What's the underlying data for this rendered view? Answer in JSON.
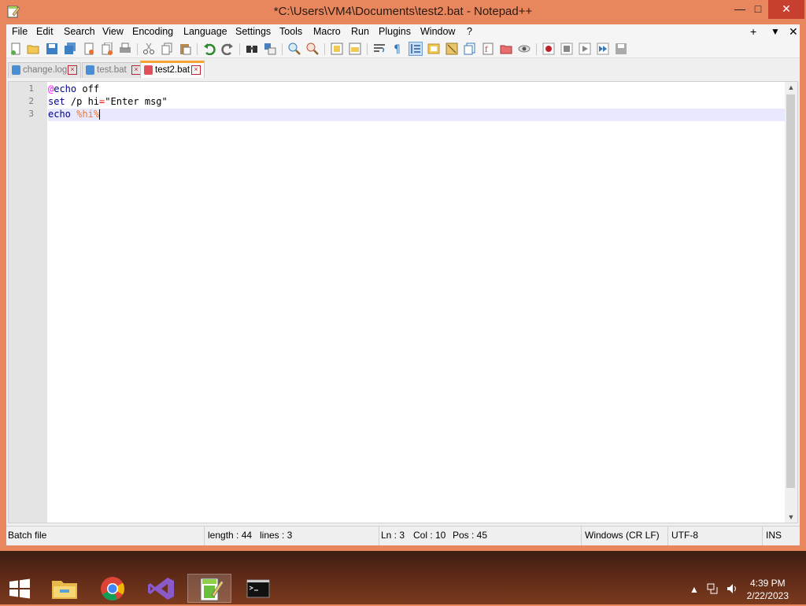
{
  "window": {
    "title": "*C:\\Users\\VM4\\Documents\\test2.bat - Notepad++",
    "minimize": "—",
    "maximize": "□",
    "close": "✕"
  },
  "menu": {
    "items": [
      "File",
      "Edit",
      "Search",
      "View",
      "Encoding",
      "Language",
      "Settings",
      "Tools",
      "Macro",
      "Run",
      "Plugins",
      "Window",
      "?"
    ],
    "right": [
      "+",
      "▼",
      "✕"
    ]
  },
  "tabs": [
    {
      "label": "change.log",
      "active": false
    },
    {
      "label": "test.bat",
      "active": false
    },
    {
      "label": "test2.bat",
      "active": true
    }
  ],
  "editor": {
    "line_numbers": [
      "1",
      "2",
      "3"
    ],
    "lines": [
      {
        "at": "@",
        "kw": "echo",
        "rest": " off"
      },
      {
        "kw": "set",
        "pre": " /p hi",
        "op": "=",
        "rest": "\"Enter msg\""
      },
      {
        "kw": "echo",
        "sp": " ",
        "var": "%hi%"
      }
    ]
  },
  "status": {
    "language": "Batch file",
    "length": "length : 44",
    "lines": "lines : 3",
    "ln": "Ln : 3",
    "col": "Col : 10",
    "pos": "Pos : 45",
    "eol": "Windows (CR LF)",
    "encoding": "UTF-8",
    "mode": "INS"
  },
  "taskbar": {
    "time": "4:39 PM",
    "date": "2/22/2023",
    "apps": [
      "start-button",
      "file-explorer",
      "chrome",
      "visual-studio",
      "notepad-plus-plus",
      "command-prompt"
    ]
  },
  "colors": {
    "accent": "#e8875d",
    "active_tab_border": "#f5a331",
    "keyword": "#00008b",
    "variable": "#f07830"
  }
}
